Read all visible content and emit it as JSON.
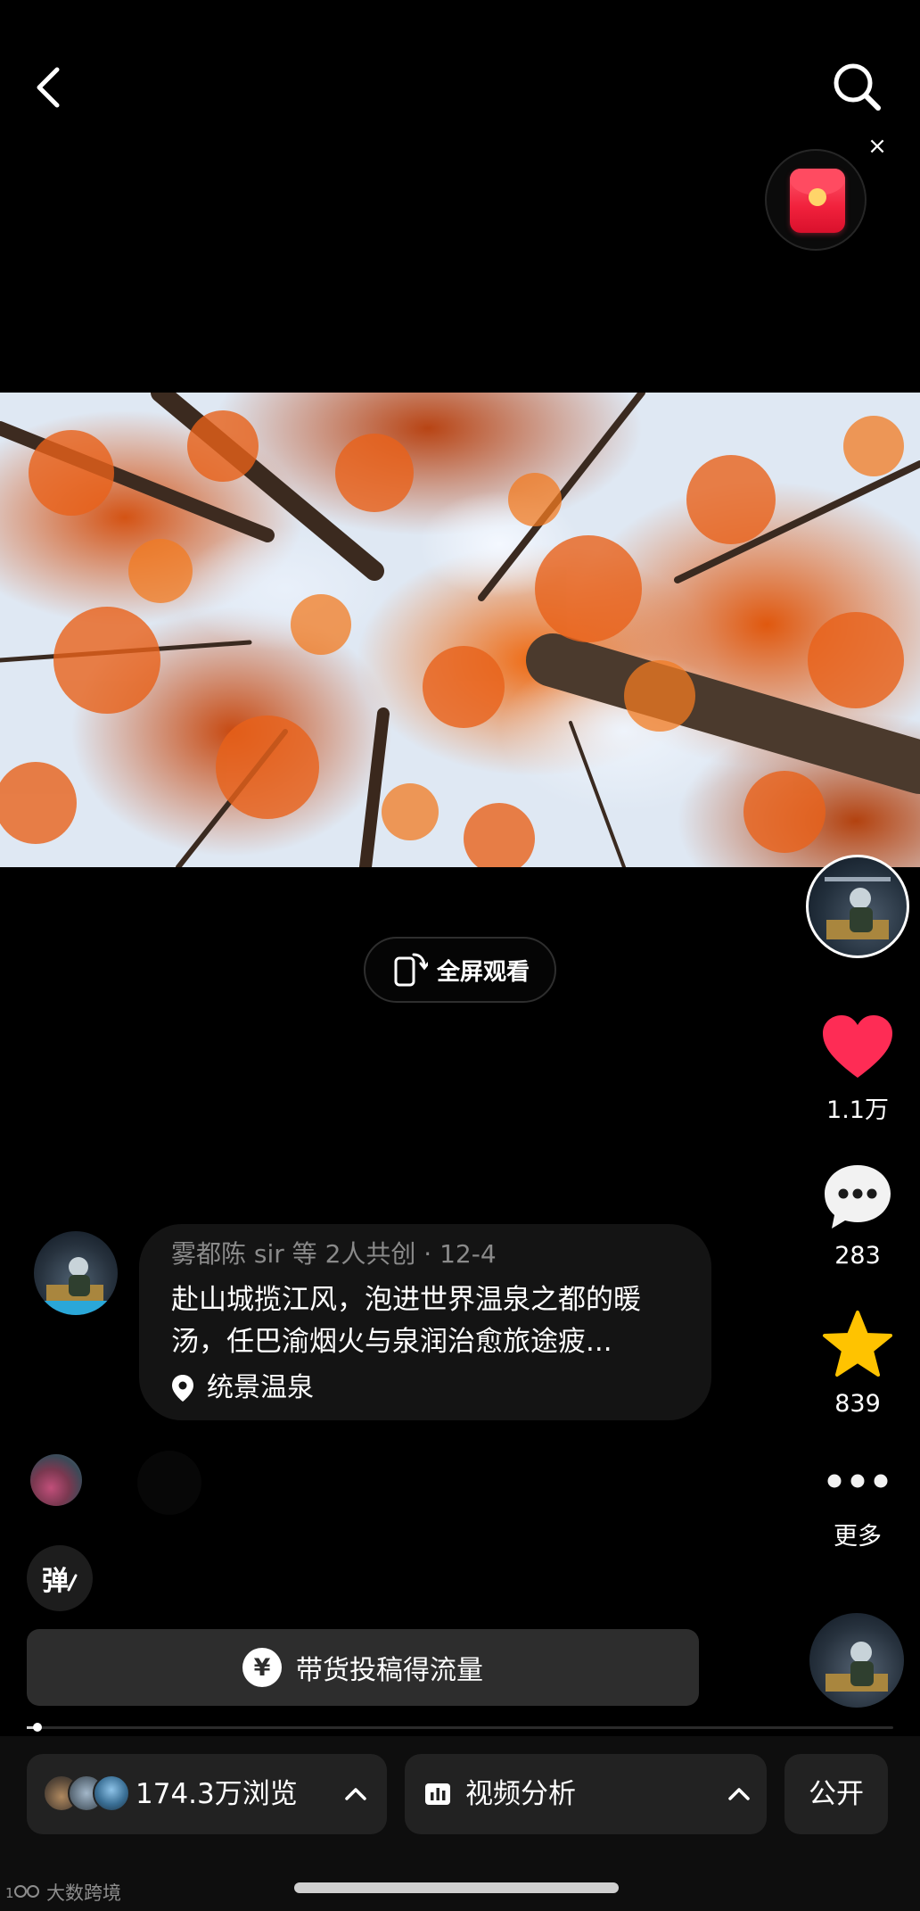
{
  "header": {
    "back_icon": "chevron-left-icon",
    "search_icon": "search-icon",
    "red_packet_icon": "red-envelope-icon",
    "close_glyph": "×"
  },
  "video": {
    "fullscreen_label": "全屏观看",
    "fullscreen_icon": "rotate-phone-icon"
  },
  "rail": {
    "like_count": "1.1万",
    "comment_count": "283",
    "favorite_count": "839",
    "more_label": "更多",
    "like_color": "#fe2c55",
    "favorite_color": "#ffc300"
  },
  "caption": {
    "meta": "雾都陈 sir 等 2人共创 · 12-4",
    "text": "赴山城揽江风，泡进世界温泉之都的暖汤，任巴渝烟火与泉润治愈旅途疲...",
    "location": "统景温泉",
    "location_icon": "location-pin-icon"
  },
  "controls": {
    "danmaku_label": "弹",
    "promo_icon": "¥",
    "promo_label": "带货投稿得流量",
    "progress": 0.01
  },
  "bottom_bar": {
    "views_label": "174.3万浏览",
    "analytics_label": "视频分析",
    "analytics_icon": "bar-chart-icon",
    "public_label": "公开"
  },
  "watermark": "大数跨境"
}
